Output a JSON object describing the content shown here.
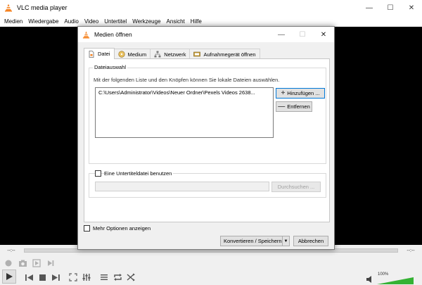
{
  "app": {
    "title": "VLC media player",
    "menu": [
      "Medien",
      "Wiedergabe",
      "Audio",
      "Video",
      "Untertitel",
      "Werkzeuge",
      "Ansicht",
      "Hilfe"
    ]
  },
  "player": {
    "time_elapsed": "--:--",
    "time_total": "--:--",
    "volume_label": "100%",
    "volume_level": 1.0
  },
  "dialog": {
    "title": "Medien öffnen",
    "tabs": [
      "Datei",
      "Medium",
      "Netzwerk",
      "Aufnahmegerät öffnen"
    ],
    "file_group_legend": "Dateiauswahl",
    "file_hint": "Mit der folgenden Liste und den Knöpfen können Sie lokale Dateien auswählen.",
    "file_entry": "C:\\Users\\Administrator\\Videos\\Neuer Ordner\\Pexels Videos 2638...",
    "add_button": "Hinzufügen ...",
    "remove_button": "Entfernen",
    "subtitle_checkbox_label": "Eine Untertiteldatei benutzen",
    "subtitle_checked": false,
    "browse_button": "Durchsuchen ...",
    "more_options_label": "Mehr Optionen anzeigen",
    "more_options_checked": false,
    "convert_button": "Konvertieren / Speichern",
    "cancel_button": "Abbrechen"
  },
  "colors": {
    "accent": "#0078d7",
    "vlc_orange": "#f58220",
    "volume_green": "#34b233"
  }
}
